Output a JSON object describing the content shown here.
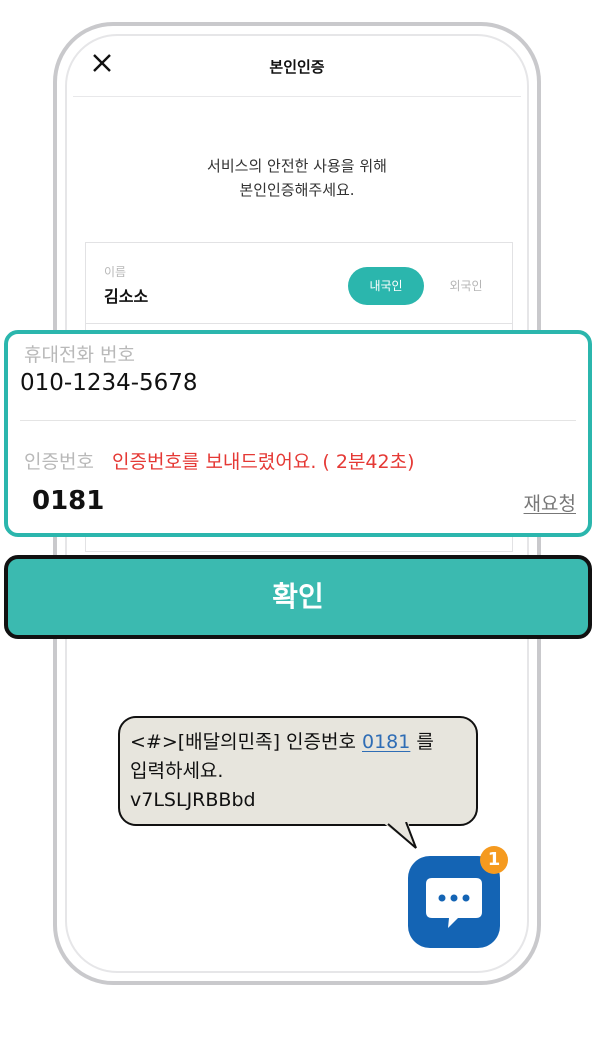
{
  "header": {
    "title": "본인인증"
  },
  "intro": {
    "line1": "서비스의 안전한 사용을 위해",
    "line2": "본인인증해주세요."
  },
  "name_field": {
    "label": "이름",
    "value": "김소소"
  },
  "nationality": {
    "domestic_label": "내국인",
    "foreign_label": "외국인",
    "selected": "내국인"
  },
  "phone_field": {
    "label": "휴대전화 번호",
    "value": "010-1234-5678"
  },
  "code_field": {
    "label": "인증번호",
    "message": "인증번호를 보내드렸어요. ( 2분42초)",
    "value": "0181",
    "resend_label": "재요청"
  },
  "confirm": {
    "label": "확인"
  },
  "sms": {
    "part1": "<#>[배달의민족] 인증번호 ",
    "code": "0181",
    "part2": " 를",
    "line2": "입력하세요.",
    "line3": "v7LSLJRBBbd"
  },
  "chat_app": {
    "badge_count": "1",
    "icon": "chat-bubble-icon"
  },
  "colors": {
    "accent": "#2bb6ad",
    "error": "#e53935",
    "chat_blue": "#1464b4",
    "badge": "#f59a1f"
  }
}
